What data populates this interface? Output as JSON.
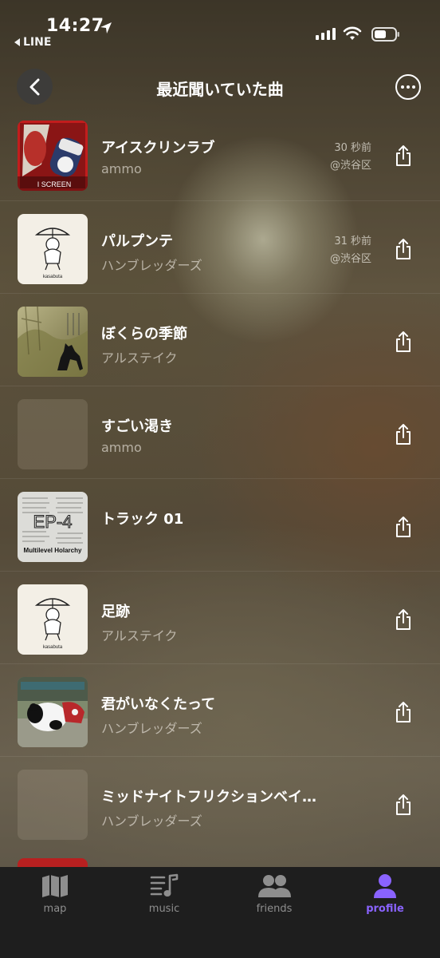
{
  "status_bar": {
    "time": "14:27",
    "back_app": "LINE"
  },
  "nav": {
    "title": "最近聞いていた曲"
  },
  "tracks": [
    {
      "title": "アイスクリンラブ",
      "artist": "ammo",
      "time": "30 秒前",
      "place": "@渋谷区",
      "art_text": "I SCREEN"
    },
    {
      "title": "パルプンテ",
      "artist": "ハンブレッダーズ",
      "time": "31 秒前",
      "place": "@渋谷区",
      "art_text": "kasabuta"
    },
    {
      "title": "ぼくらの季節",
      "artist": "アルステイク"
    },
    {
      "title": "すごい渇き",
      "artist": "ammo"
    },
    {
      "title": "トラック 01",
      "artist": "",
      "art_text": "EP-4",
      "art_subtext": "Multilevel Holarchy"
    },
    {
      "title": "足跡",
      "artist": "アルステイク",
      "art_text": "kasabuta"
    },
    {
      "title": "君がいなくたって",
      "artist": "ハンブレッダーズ"
    },
    {
      "title": "ミッドナイトフリクションベイ…",
      "artist": "ハンブレッダーズ"
    }
  ],
  "tabs": {
    "map": "map",
    "music": "music",
    "friends": "friends",
    "profile": "profile"
  },
  "colors": {
    "accent": "#8a63ff",
    "tabbar_bg": "#1e1e1e"
  }
}
